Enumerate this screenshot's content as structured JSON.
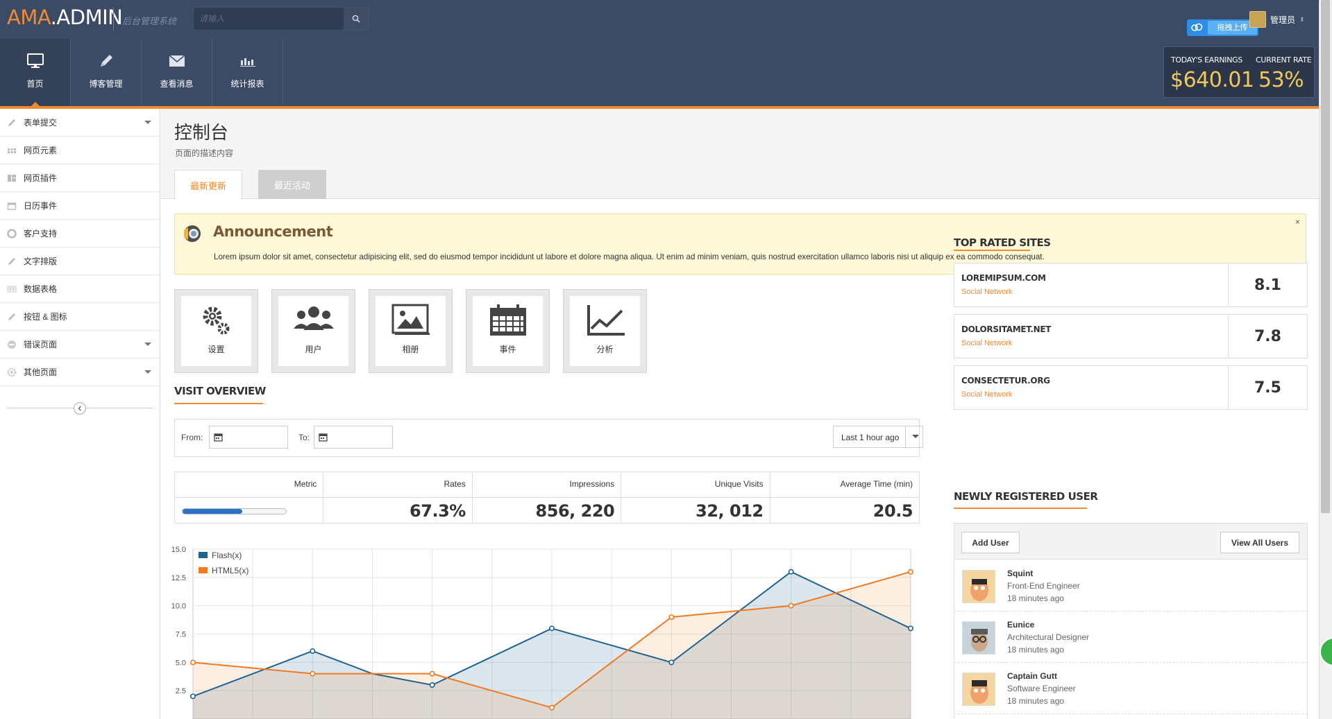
{
  "header": {
    "logo_part1": "AMA",
    "logo_dot": ".",
    "logo_part2": "ADMIN",
    "subtitle": "后台管理系统",
    "search_placeholder": "请输入",
    "upload_label": "拖拽上传",
    "user_name": "管理员"
  },
  "nav": [
    {
      "label": "首页",
      "icon": "monitor-icon"
    },
    {
      "label": "博客管理",
      "icon": "pencil-icon"
    },
    {
      "label": "查看消息",
      "icon": "envelope-icon"
    },
    {
      "label": "统计报表",
      "icon": "bar-chart-icon"
    }
  ],
  "stats": {
    "earnings_label": "TODAY'S EARNINGS",
    "earnings_value": "$640.01",
    "rate_label": "CURRENT RATE",
    "rate_value": "53%"
  },
  "sidebar": {
    "items": [
      {
        "label": "表单提交",
        "icon": "pencil-icon",
        "dropdown": true
      },
      {
        "label": "网页元素",
        "icon": "grid-icon",
        "dropdown": false
      },
      {
        "label": "网页插件",
        "icon": "layout-icon",
        "dropdown": false
      },
      {
        "label": "日历事件",
        "icon": "calendar-icon",
        "dropdown": false
      },
      {
        "label": "客户支持",
        "icon": "lifebuoy-icon",
        "dropdown": false
      },
      {
        "label": "文字排版",
        "icon": "pen-icon",
        "dropdown": false
      },
      {
        "label": "数据表格",
        "icon": "table-icon",
        "dropdown": false
      },
      {
        "label": "按钮 & 图标",
        "icon": "brush-icon",
        "dropdown": false
      },
      {
        "label": "错误页面",
        "icon": "minus-circle-icon",
        "dropdown": true
      },
      {
        "label": "其他页面",
        "icon": "gear-icon",
        "dropdown": true
      }
    ]
  },
  "page": {
    "title": "控制台",
    "description": "页面的描述内容",
    "tabs": [
      "最新更新",
      "最近活动"
    ]
  },
  "announcement": {
    "title": "Announcement",
    "body": "Lorem ipsum dolor sit amet, consectetur adipisicing elit, sed do eiusmod tempor incididunt ut labore et dolore magna aliqua. Ut enim ad minim veniam, quis nostrud exercitation ullamco laboris nisi ut aliquip ex ea commodo consequat.",
    "close": "×"
  },
  "shortcuts": [
    {
      "label": "设置",
      "icon": "gears-icon"
    },
    {
      "label": "用户",
      "icon": "users-icon"
    },
    {
      "label": "相册",
      "icon": "pictures-icon"
    },
    {
      "label": "事件",
      "icon": "calendar-icon"
    },
    {
      "label": "分析",
      "icon": "line-chart-icon"
    }
  ],
  "visit": {
    "heading": "VISIT OVERVIEW",
    "from_label": "From:",
    "to_label": "To:",
    "range": "Last 1 hour ago",
    "metrics_header": [
      "Metric",
      "Rates",
      "Impressions",
      "Unique Visits",
      "Average Time (min)"
    ],
    "metric_progress": 0.58,
    "values": [
      "67.3%",
      "856, 220",
      "32, 012",
      "20.5"
    ]
  },
  "chart_data": {
    "type": "area",
    "x": [
      0,
      1,
      2,
      3,
      4,
      5,
      6,
      7,
      8,
      9,
      10,
      11,
      12
    ],
    "ylim": [
      0,
      15
    ],
    "yticks": [
      "2.5",
      "5.0",
      "7.5",
      "10.0",
      "12.5",
      "15.0"
    ],
    "grid": true,
    "legend": "top-left",
    "series": [
      {
        "name": "Flash(x)",
        "color": "#1f6390",
        "values": [
          2,
          4,
          6,
          4,
          3,
          5.5,
          8,
          6.5,
          5,
          9,
          13,
          10.5,
          8
        ]
      },
      {
        "name": "HTML5(x)",
        "color": "#f07a22",
        "values": [
          5,
          4.5,
          4,
          4,
          4,
          2.5,
          1,
          5,
          9,
          9.5,
          10,
          11.5,
          13
        ]
      }
    ]
  },
  "top_sites": {
    "heading": "TOP RATED SITES",
    "items": [
      {
        "name": "LOREMIPSUM.COM",
        "category": "Social Network",
        "score": "8.1"
      },
      {
        "name": "DOLORSITAMET.NET",
        "category": "Social Network",
        "score": "7.8"
      },
      {
        "name": "CONSECTETUR.ORG",
        "category": "Social Network",
        "score": "7.5"
      }
    ]
  },
  "new_users": {
    "heading": "NEWLY REGISTERED USER",
    "add_label": "Add User",
    "view_label": "View All Users",
    "items": [
      {
        "name": "Squint",
        "role": "Front-End Engineer",
        "time": "18 minutes ago"
      },
      {
        "name": "Eunice",
        "role": "Architectural Designer",
        "time": "18 minutes ago"
      },
      {
        "name": "Captain Gutt",
        "role": "Software Engineer",
        "time": "18 minutes ago"
      }
    ]
  },
  "colors": {
    "accent": "#f28a2f",
    "header_bg": "#3b4b66",
    "flash": "#1f6390",
    "html5": "#f07a22"
  }
}
